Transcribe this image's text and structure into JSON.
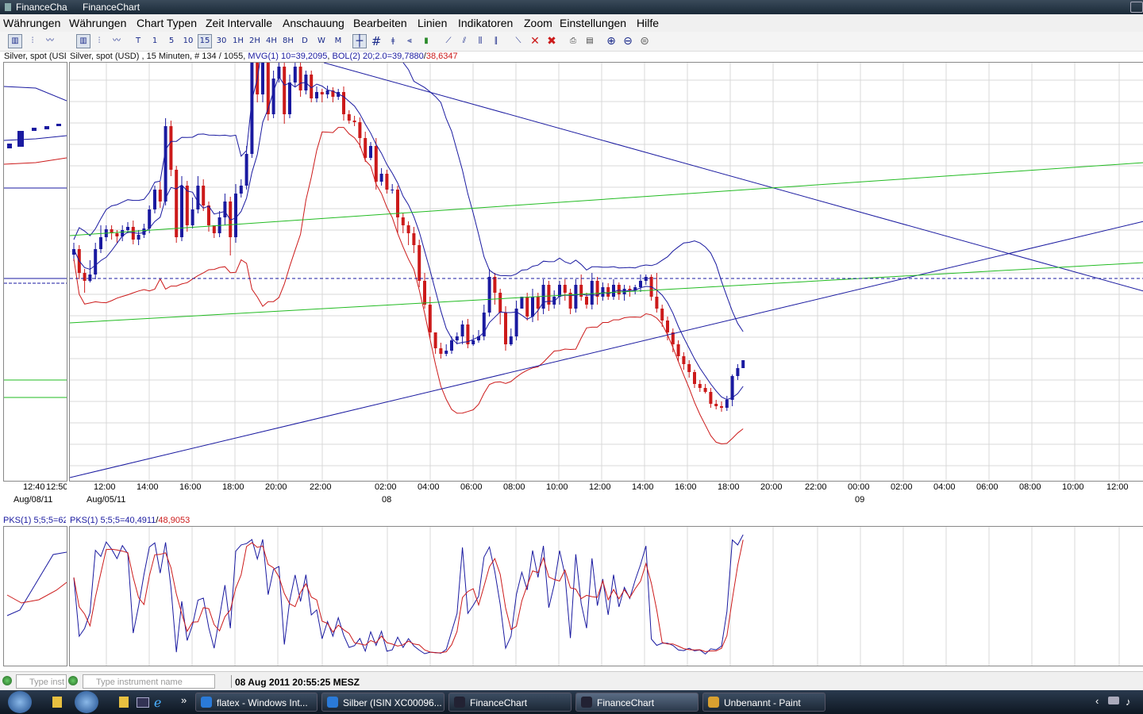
{
  "titlebar": {
    "title_left": "FinanceCha",
    "title_main": "FinanceChart"
  },
  "menu": [
    "Währungen",
    "Währungen",
    "Chart Typen",
    "Zeit Intervalle",
    "Anschauung",
    "Bearbeiten",
    "Linien",
    "Indikatoren",
    "Zoom",
    "Einstellungen",
    "Hilfe"
  ],
  "toolbar": {
    "intervals": [
      "T",
      "1",
      "5",
      "10",
      "15",
      "30",
      "1H",
      "2H",
      "4H",
      "8H",
      "D",
      "W",
      "M"
    ],
    "selected_interval": "15"
  },
  "info": {
    "left": "Silver, spot (USD",
    "main_prefix": "Silver, spot (USD) , 15 Minuten, # 134 / 1055, ",
    "mvg": "MVG(1) 10=39,2095",
    "bol_sep": ", ",
    "bol": "BOL(2) 20;2.0=39,7880",
    "bol_sep2": "/",
    "bol2": "38,6347"
  },
  "osc_info": {
    "left": "PKS(1) 5;5;5=62",
    "main": "PKS(1) 5;5;5=40,4911",
    "sep": "/",
    "second": "48,9053"
  },
  "xaxis": {
    "left_times": [
      "12:40",
      "12:50"
    ],
    "left_date": "Aug/08/11",
    "main_date": "Aug/05/11",
    "times": [
      "12:00",
      "14:00",
      "16:00",
      "18:00",
      "20:00",
      "22:00",
      "02:00",
      "04:00",
      "06:00",
      "08:00",
      "10:00",
      "12:00",
      "14:00",
      "16:00",
      "18:00",
      "20:00",
      "22:00",
      "00:00",
      "02:00",
      "04:00",
      "06:00",
      "08:00",
      "10:00",
      "12:00"
    ],
    "day_labels": [
      "08",
      "09"
    ]
  },
  "status": {
    "search_placeholder_small": "Type inst",
    "search_placeholder": "Type instrument name",
    "datetime": "08 Aug 2011 20:55:25 MESZ"
  },
  "taskbar": [
    {
      "label": "flatex - Windows Int...",
      "active": false
    },
    {
      "label": "Silber (ISIN XC00096...",
      "active": false
    },
    {
      "label": "FinanceChart",
      "active": false
    },
    {
      "label": "FinanceChart",
      "active": true
    },
    {
      "label": "Unbenannt - Paint",
      "active": false
    }
  ],
  "colors": {
    "bull": "#1a1aa0",
    "bear": "#cc1a1a",
    "band": "#1a1aa0",
    "band_lower": "#cc1a1a",
    "trend": "#1a1aa0",
    "channel": "#22bb22",
    "grid": "#d8d8d8"
  },
  "chart_data": {
    "type": "candlestick",
    "instrument": "Silver, spot (USD)",
    "interval": "15 Minuten",
    "candles": [
      [
        263,
        270,
        255,
        278
      ],
      [
        270,
        240,
        232,
        275
      ],
      [
        240,
        230,
        215,
        245
      ],
      [
        230,
        238,
        228,
        256
      ],
      [
        238,
        270,
        232,
        278
      ],
      [
        270,
        285,
        265,
        300
      ],
      [
        285,
        295,
        280,
        300
      ],
      [
        295,
        290,
        282,
        300
      ],
      [
        290,
        286,
        278,
        294
      ],
      [
        286,
        294,
        280,
        300
      ],
      [
        294,
        298,
        290,
        304
      ],
      [
        298,
        282,
        276,
        306
      ],
      [
        282,
        288,
        275,
        294
      ],
      [
        288,
        296,
        284,
        302
      ],
      [
        296,
        320,
        290,
        325
      ],
      [
        320,
        345,
        315,
        350
      ],
      [
        345,
        330,
        322,
        355
      ],
      [
        330,
        425,
        325,
        435
      ],
      [
        425,
        370,
        362,
        432
      ],
      [
        370,
        285,
        278,
        375
      ],
      [
        285,
        350,
        280,
        362
      ],
      [
        350,
        300,
        292,
        356
      ],
      [
        300,
        320,
        296,
        335
      ],
      [
        320,
        350,
        315,
        362
      ],
      [
        350,
        325,
        318,
        358
      ],
      [
        325,
        300,
        292,
        330
      ],
      [
        300,
        290,
        284,
        296
      ],
      [
        290,
        310,
        285,
        318
      ],
      [
        310,
        330,
        300,
        340
      ],
      [
        330,
        285,
        262,
        336
      ],
      [
        285,
        340,
        278,
        352
      ],
      [
        340,
        350,
        335,
        358
      ],
      [
        350,
        390,
        345,
        400
      ],
      [
        390,
        505,
        385,
        515
      ],
      [
        505,
        465,
        455,
        510
      ],
      [
        465,
        530,
        455,
        540
      ],
      [
        530,
        440,
        432,
        535
      ],
      [
        440,
        485,
        435,
        495
      ],
      [
        485,
        500,
        480,
        508
      ],
      [
        500,
        440,
        428,
        506
      ],
      [
        440,
        480,
        435,
        490
      ],
      [
        480,
        500,
        475,
        520
      ],
      [
        500,
        470,
        462,
        506
      ],
      [
        470,
        490,
        465,
        495
      ],
      [
        490,
        460,
        455,
        495
      ],
      [
        460,
        468,
        455,
        475
      ],
      [
        468,
        465,
        455,
        472
      ],
      [
        465,
        470,
        460,
        476
      ],
      [
        470,
        462,
        455,
        474
      ],
      [
        462,
        468,
        458,
        472
      ],
      [
        468,
        440,
        432,
        475
      ],
      [
        440,
        432,
        428,
        445
      ],
      [
        432,
        430,
        425,
        438
      ],
      [
        430,
        410,
        398,
        436
      ],
      [
        410,
        385,
        380,
        418
      ],
      [
        385,
        400,
        382,
        405
      ],
      [
        400,
        355,
        345,
        410
      ],
      [
        355,
        365,
        350,
        372
      ],
      [
        365,
        345,
        340,
        370
      ],
      [
        345,
        345,
        340,
        352
      ],
      [
        345,
        310,
        290,
        350
      ],
      [
        310,
        300,
        290,
        315
      ],
      [
        300,
        290,
        275,
        305
      ],
      [
        290,
        275,
        265,
        298
      ],
      [
        275,
        230,
        222,
        282
      ],
      [
        230,
        200,
        195,
        240
      ],
      [
        200,
        165,
        158,
        210
      ],
      [
        165,
        145,
        138,
        160
      ],
      [
        145,
        138,
        132,
        152
      ],
      [
        138,
        142,
        135,
        150
      ],
      [
        142,
        155,
        138,
        160
      ],
      [
        155,
        160,
        150,
        165
      ],
      [
        160,
        175,
        150,
        180
      ],
      [
        175,
        150,
        145,
        182
      ],
      [
        150,
        155,
        148,
        162
      ],
      [
        155,
        160,
        152,
        168
      ],
      [
        160,
        190,
        155,
        200
      ],
      [
        190,
        235,
        185,
        245
      ],
      [
        235,
        215,
        200,
        240
      ],
      [
        215,
        190,
        175,
        220
      ],
      [
        190,
        150,
        142,
        198
      ],
      [
        150,
        160,
        148,
        170
      ],
      [
        160,
        195,
        155,
        205
      ],
      [
        195,
        210,
        195,
        210
      ],
      [
        210,
        185,
        180,
        215
      ],
      [
        185,
        210,
        178,
        220
      ],
      [
        210,
        195,
        180,
        215
      ],
      [
        195,
        225,
        188,
        232
      ],
      [
        225,
        200,
        192,
        230
      ],
      [
        200,
        210,
        195,
        218
      ],
      [
        210,
        225,
        200,
        230
      ],
      [
        225,
        215,
        205,
        232
      ],
      [
        215,
        195,
        188,
        220
      ],
      [
        195,
        225,
        190,
        232
      ],
      [
        225,
        210,
        205,
        238
      ],
      [
        210,
        200,
        195,
        215
      ],
      [
        200,
        230,
        194,
        240
      ],
      [
        230,
        210,
        200,
        235
      ],
      [
        210,
        222,
        205,
        228
      ],
      [
        222,
        210,
        206,
        227
      ],
      [
        210,
        225,
        206,
        232
      ],
      [
        225,
        213,
        206,
        228
      ],
      [
        213,
        220,
        205,
        225
      ],
      [
        220,
        218,
        210,
        224
      ],
      [
        218,
        222,
        213,
        225
      ],
      [
        222,
        230,
        216,
        238
      ],
      [
        230,
        235,
        225,
        238
      ],
      [
        235,
        210,
        205,
        238
      ],
      [
        210,
        195,
        190,
        240
      ],
      [
        195,
        180,
        172,
        200
      ],
      [
        180,
        165,
        155,
        185
      ],
      [
        165,
        150,
        140,
        170
      ],
      [
        150,
        135,
        128,
        155
      ],
      [
        135,
        125,
        118,
        140
      ],
      [
        125,
        115,
        108,
        130
      ],
      [
        115,
        100,
        95,
        118
      ],
      [
        100,
        95,
        90,
        105
      ],
      [
        95,
        90,
        88,
        100
      ],
      [
        90,
        75,
        70,
        95
      ],
      [
        75,
        72,
        68,
        80
      ],
      [
        72,
        70,
        65,
        78
      ],
      [
        70,
        80,
        66,
        85
      ],
      [
        80,
        110,
        72,
        112
      ],
      [
        110,
        120,
        105,
        125
      ],
      [
        120,
        130,
        120,
        130
      ]
    ],
    "moving_average": "MVG(1) 10",
    "bollinger": "BOL(2) 20;2.0",
    "oscillator": "PKS(1) 5;5;5",
    "x_labels": [
      "12:00",
      "14:00",
      "16:00",
      "18:00",
      "20:00",
      "22:00",
      "02:00",
      "04:00",
      "06:00",
      "08:00",
      "10:00",
      "12:00",
      "14:00",
      "16:00",
      "18:00",
      "20:00"
    ]
  }
}
